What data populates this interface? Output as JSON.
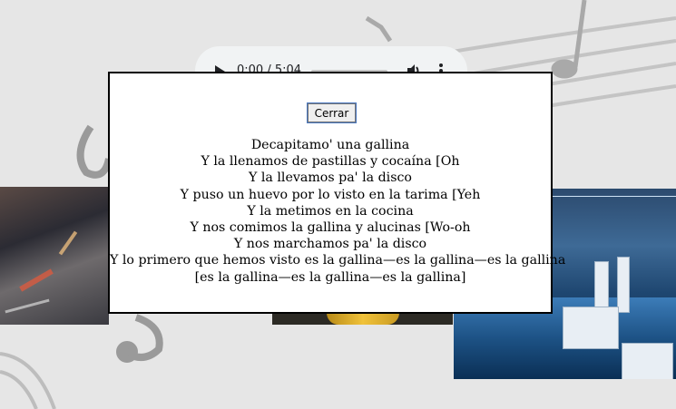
{
  "audio": {
    "time_display": "0:00 / 5:04",
    "progress": 0.0
  },
  "modal": {
    "close_label": "Cerrar",
    "lyrics": [
      "Decapitamo' una gallina",
      "Y la llenamos de pastillas y cocaína [Oh",
      "Y la llevamos pa' la disco",
      "Y puso un huevo por lo visto en la tarima [Yeh",
      "Y la metimos en la cocina",
      "Y nos comimos la gallina y alucinas [Wo-oh",
      "Y nos marchamos pa' la disco",
      "Y lo primero que hemos visto es la gallina—es la gallina—es la gallina",
      "[es la gallina—es la gallina—es la gallina]"
    ]
  },
  "icons": [
    "play-icon",
    "volume-icon",
    "more-options-icon",
    "music-note-icon",
    "treble-clef-icon"
  ]
}
